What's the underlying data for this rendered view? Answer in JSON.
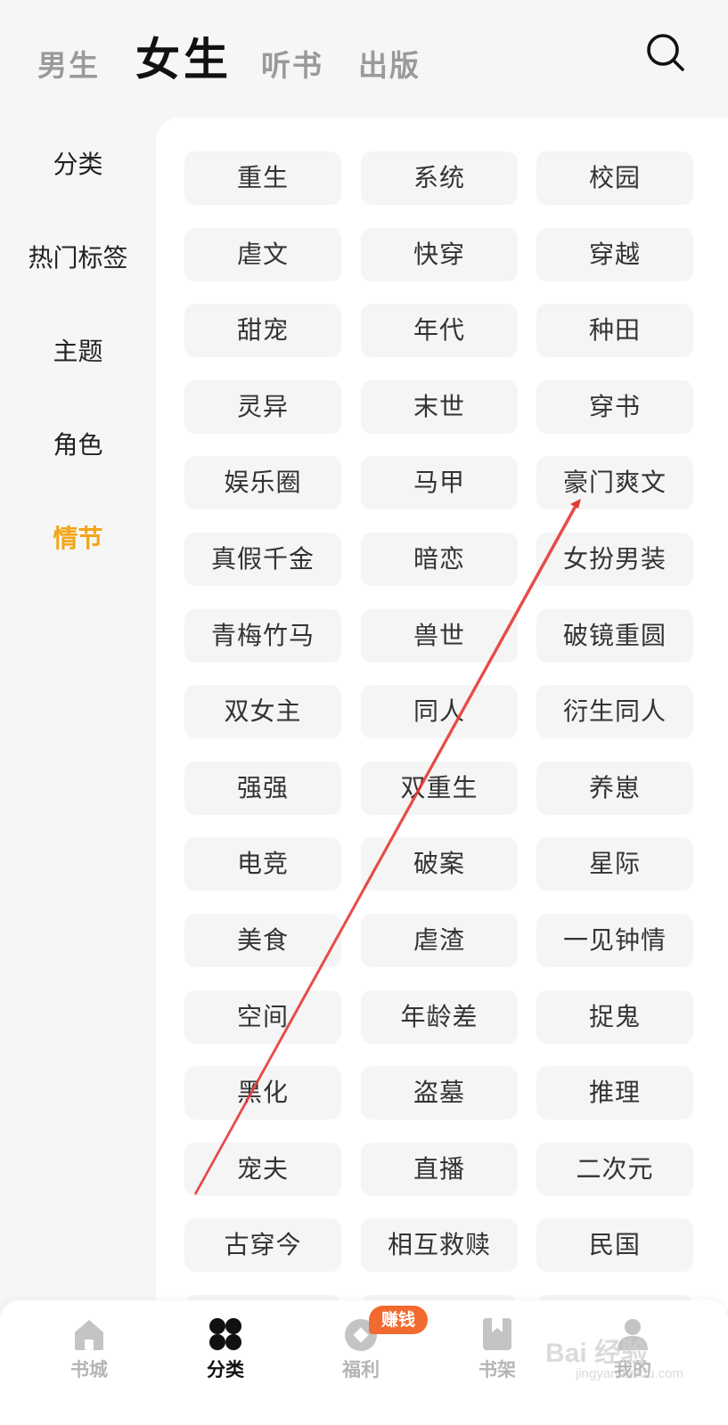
{
  "top_tabs": [
    {
      "label": "男生",
      "active": false
    },
    {
      "label": "女生",
      "active": true
    },
    {
      "label": "听书",
      "active": false
    },
    {
      "label": "出版",
      "active": false
    }
  ],
  "search": {
    "icon": "search-icon"
  },
  "side_nav": [
    {
      "label": "分类",
      "active": false
    },
    {
      "label": "热门标签",
      "active": false
    },
    {
      "label": "主题",
      "active": false
    },
    {
      "label": "角色",
      "active": false
    },
    {
      "label": "情节",
      "active": true
    }
  ],
  "tags": [
    "重生",
    "系统",
    "校园",
    "虐文",
    "快穿",
    "穿越",
    "甜宠",
    "年代",
    "种田",
    "灵异",
    "末世",
    "穿书",
    "娱乐圈",
    "马甲",
    "豪门爽文",
    "真假千金",
    "暗恋",
    "女扮男装",
    "青梅竹马",
    "兽世",
    "破镜重圆",
    "双女主",
    "同人",
    "衍生同人",
    "强强",
    "双重生",
    "养崽",
    "电竞",
    "破案",
    "星际",
    "美食",
    "虐渣",
    "一见钟情",
    "空间",
    "年龄差",
    "捉鬼",
    "黑化",
    "盗墓",
    "推理",
    "宠夫",
    "直播",
    "二次元",
    "古穿今",
    "相互救赎",
    "民国"
  ],
  "bottom_nav": [
    {
      "label": "书城",
      "icon": "home-icon",
      "active": false
    },
    {
      "label": "分类",
      "icon": "category-icon",
      "active": true
    },
    {
      "label": "福利",
      "icon": "coin-icon",
      "active": false,
      "badge": "赚钱"
    },
    {
      "label": "书架",
      "icon": "bookshelf-icon",
      "active": false
    },
    {
      "label": "我的",
      "icon": "profile-icon",
      "active": false
    }
  ],
  "watermark": {
    "text": "Bai 经验",
    "sub": "jingyan.baidu.com"
  },
  "colors": {
    "accent": "#f2a516",
    "badge": "#f26a2f",
    "arrow": "#e53935",
    "tag_bg": "#f5f5f5",
    "inactive": "#b5b5b5"
  }
}
